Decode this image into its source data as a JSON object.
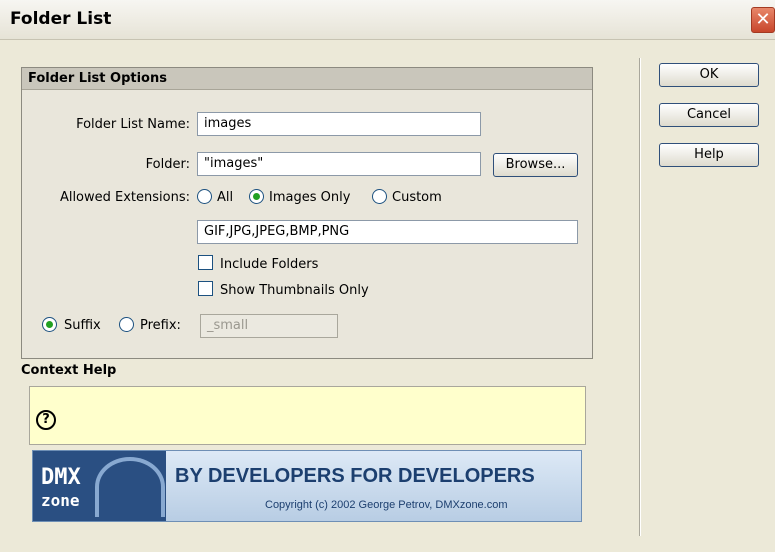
{
  "window": {
    "title": "Folder List",
    "close_glyph": "✕"
  },
  "options": {
    "header": "Folder List Options",
    "folder_list_name_label": "Folder List Name:",
    "folder_list_name_value": "images",
    "folder_label": "Folder:",
    "folder_value": "\"images\"",
    "browse_label": "Browse...",
    "allowed_ext_label": "Allowed Extensions:",
    "radio_all": "All",
    "radio_images_only": "Images Only",
    "radio_custom": "Custom",
    "extensions_value": "GIF,JPG,JPEG,BMP,PNG",
    "include_folders": "Include Folders",
    "show_thumbnails_only": "Show Thumbnails Only",
    "suffix_label": "Suffix",
    "prefix_label": "Prefix:",
    "suffix_value": "_small"
  },
  "buttons": {
    "ok": "OK",
    "cancel": "Cancel",
    "help": "Help"
  },
  "context_help": {
    "title": "Context Help",
    "icon": "?"
  },
  "banner": {
    "logo_top": "DMX",
    "logo_bottom": "zone",
    "slogan": "BY DEVELOPERS FOR DEVELOPERS",
    "copyright": "Copyright (c) 2002 George Petrov, DMXzone.com"
  }
}
